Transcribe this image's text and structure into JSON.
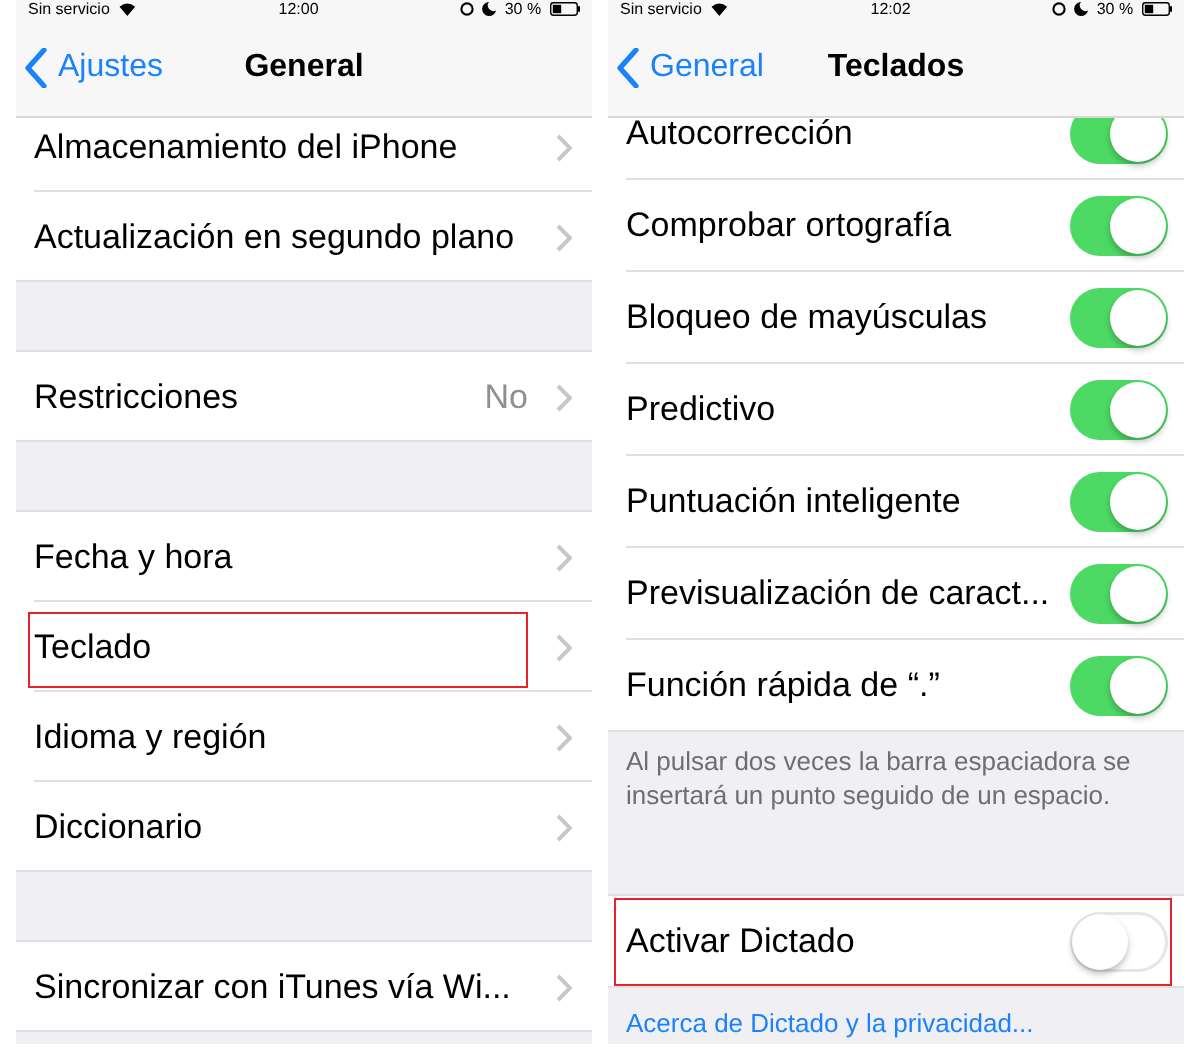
{
  "panels": [
    {
      "status": {
        "carrier": "Sin servicio",
        "time": "12:00",
        "battery": "30 %"
      },
      "nav": {
        "back": "Ajustes",
        "title": "General"
      },
      "items": [
        {
          "kind": "row",
          "label": "Almacenamiento del iPhone"
        },
        {
          "kind": "row",
          "label": "Actualización en segundo plano"
        },
        {
          "kind": "gap"
        },
        {
          "kind": "row",
          "label": "Restricciones",
          "value": "No"
        },
        {
          "kind": "gap"
        },
        {
          "kind": "row",
          "label": "Fecha y hora"
        },
        {
          "kind": "row",
          "label": "Teclado",
          "highlighted": true
        },
        {
          "kind": "row",
          "label": "Idioma y región"
        },
        {
          "kind": "row",
          "label": "Diccionario"
        },
        {
          "kind": "gap"
        },
        {
          "kind": "row",
          "label": "Sincronizar con iTunes vía Wi..."
        }
      ]
    },
    {
      "status": {
        "carrier": "Sin servicio",
        "time": "12:02",
        "battery": "30 %"
      },
      "nav": {
        "back": "General",
        "title": "Teclados"
      },
      "items": [
        {
          "kind": "toggle",
          "label": "Autocorrección",
          "on": true
        },
        {
          "kind": "toggle",
          "label": "Comprobar ortografía",
          "on": true
        },
        {
          "kind": "toggle",
          "label": "Bloqueo de mayúsculas",
          "on": true
        },
        {
          "kind": "toggle",
          "label": "Predictivo",
          "on": true
        },
        {
          "kind": "toggle",
          "label": "Puntuación inteligente",
          "on": true
        },
        {
          "kind": "toggle",
          "label": "Previsualización de caract...",
          "on": true
        },
        {
          "kind": "toggle",
          "label": "Función rápida de “.”",
          "on": true
        },
        {
          "kind": "footer",
          "text": "Al pulsar dos veces la barra espaciadora se insertará un punto seguido de un espacio."
        },
        {
          "kind": "toggle",
          "label": "Activar Dictado",
          "on": false,
          "highlighted": true
        },
        {
          "kind": "link",
          "text": "Acerca de Dictado y la privacidad..."
        }
      ]
    }
  ]
}
